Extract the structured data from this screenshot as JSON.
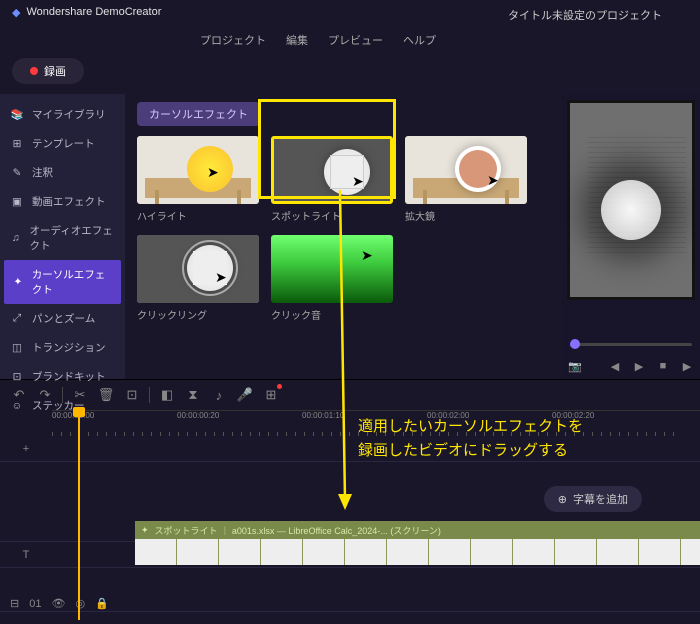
{
  "app": {
    "title": "Wondershare DemoCreator",
    "project": "タイトル未設定のプロジェクト"
  },
  "menu": {
    "project": "プロジェクト",
    "edit": "編集",
    "preview": "プレビュー",
    "help": "ヘルプ"
  },
  "record_btn": "録画",
  "sidebar": {
    "items": [
      {
        "icon": "library",
        "label": "マイライブラリ"
      },
      {
        "icon": "template",
        "label": "テンプレート"
      },
      {
        "icon": "annotation",
        "label": "注釈"
      },
      {
        "icon": "video-fx",
        "label": "動画エフェクト"
      },
      {
        "icon": "audio-fx",
        "label": "オーディオエフェクト"
      },
      {
        "icon": "cursor-fx",
        "label": "カーソルエフェクト"
      },
      {
        "icon": "panzoom",
        "label": "パンとズーム"
      },
      {
        "icon": "transition",
        "label": "トランジション"
      },
      {
        "icon": "brandkit",
        "label": "ブランドキット"
      },
      {
        "icon": "sticker",
        "label": "ステッカー"
      }
    ],
    "active": 5
  },
  "section_title": "カーソルエフェクト",
  "effects": {
    "items": [
      {
        "label": "ハイライト"
      },
      {
        "label": "スポットライト"
      },
      {
        "label": "拡大鏡"
      },
      {
        "label": "クリックリング"
      },
      {
        "label": "クリック音"
      }
    ],
    "selected": 1
  },
  "ruler": {
    "ticks": [
      "00:00:00:00",
      "00:00:00:20",
      "00:00:01:10",
      "00:00:02:00",
      "00:00:02:20"
    ]
  },
  "clip": {
    "name": "スポットライト",
    "file": "a001s.xlsx — LibreOffice Calc_2024-... (スクリーン)"
  },
  "subtitle_btn": "字幕を追加",
  "annotation": {
    "line1": "適用したいカーソルエフェクトを",
    "line2": "録画したビデオにドラッグする"
  },
  "bottom": {
    "track_count": "01"
  },
  "track_labels": {
    "add": "+",
    "text": "T"
  }
}
